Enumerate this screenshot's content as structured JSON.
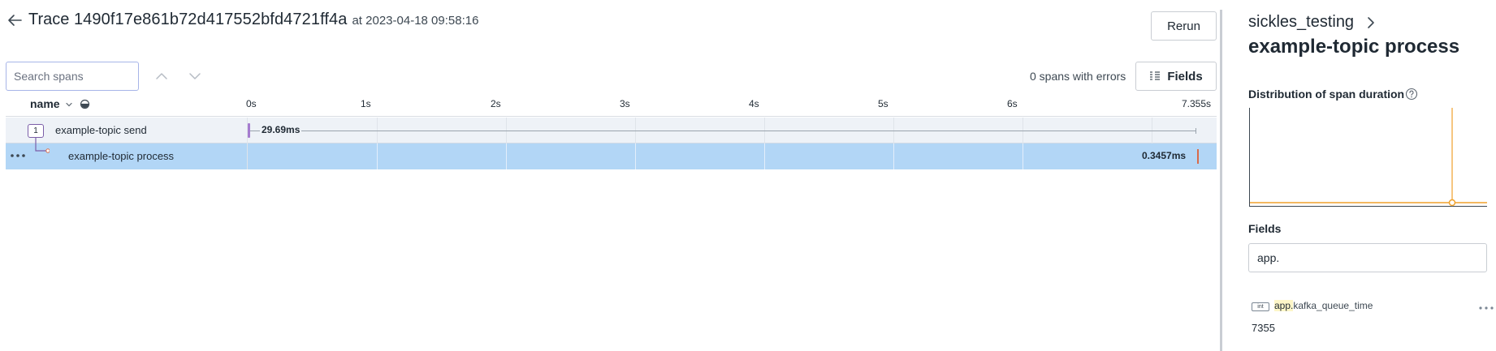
{
  "header": {
    "title_prefix": "Trace",
    "trace_id": "1490f17e861b72d417552bfd4721ff4a",
    "at_text": "at 2023-04-18 09:58:16",
    "rerun_label": "Rerun"
  },
  "toolbar": {
    "search_placeholder": "Search spans",
    "errors_text": "0 spans with errors",
    "fields_label": "Fields"
  },
  "columns": {
    "name_label": "name"
  },
  "timeline": {
    "ticks": [
      "0s",
      "1s",
      "2s",
      "3s",
      "4s",
      "5s",
      "6s",
      "7.355s"
    ],
    "total_duration_s": 7.355
  },
  "spans": [
    {
      "name": "example-topic send",
      "count": "1",
      "duration": "29.69ms"
    },
    {
      "name": "example-topic process",
      "duration": "0.3457ms"
    }
  ],
  "panel": {
    "service": "sickles_testing",
    "span_title": "example-topic process",
    "distribution_label": "Distribution of span duration",
    "fields_label": "Fields",
    "filter_value": "app.",
    "field": {
      "type": "int",
      "key_highlight": "app.",
      "key_rest": "kafka_queue_time",
      "value": "7355"
    }
  },
  "colors": {
    "accent_purple": "#7b5ea8",
    "selected_row": "#b2d6f6",
    "chart_line": "#f0a12b",
    "error_bar": "#d86a4a"
  }
}
